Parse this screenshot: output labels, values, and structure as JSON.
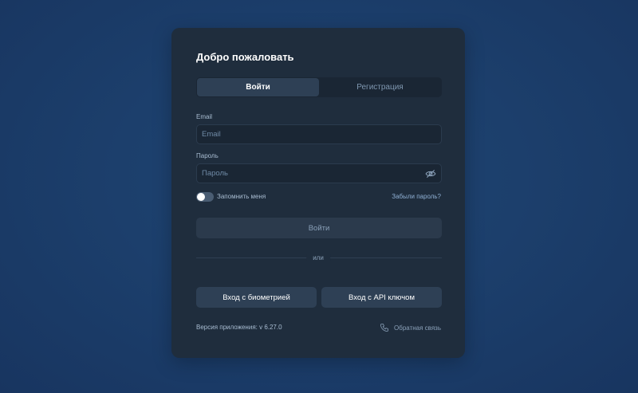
{
  "card": {
    "title": "Добро пожаловать"
  },
  "tabs": {
    "login": "Войти",
    "register": "Регистрация",
    "active": "login"
  },
  "form": {
    "email_label": "Email",
    "email_placeholder": "Email",
    "email_value": "",
    "password_label": "Пароль",
    "password_placeholder": "Пароль",
    "password_value": "",
    "remember_label": "Запомнить меня",
    "remember_checked": false,
    "forgot_link": "Забыли пароль?",
    "submit_label": "Войти"
  },
  "divider_text": "или",
  "alt_login": {
    "biometric_label": "Вход с биометрией",
    "api_key_label": "Вход с API ключом"
  },
  "footer": {
    "version_text": "Версия приложения: v 6.27.0",
    "feedback_label": "Обратная связь"
  },
  "icons": {
    "password_visibility": "eye-off-icon",
    "feedback": "phone-icon"
  },
  "colors": {
    "background": "#1c3f6c",
    "card": "#1f2d3d",
    "active_tab": "#2e4055",
    "link": "#8fb0d4"
  }
}
